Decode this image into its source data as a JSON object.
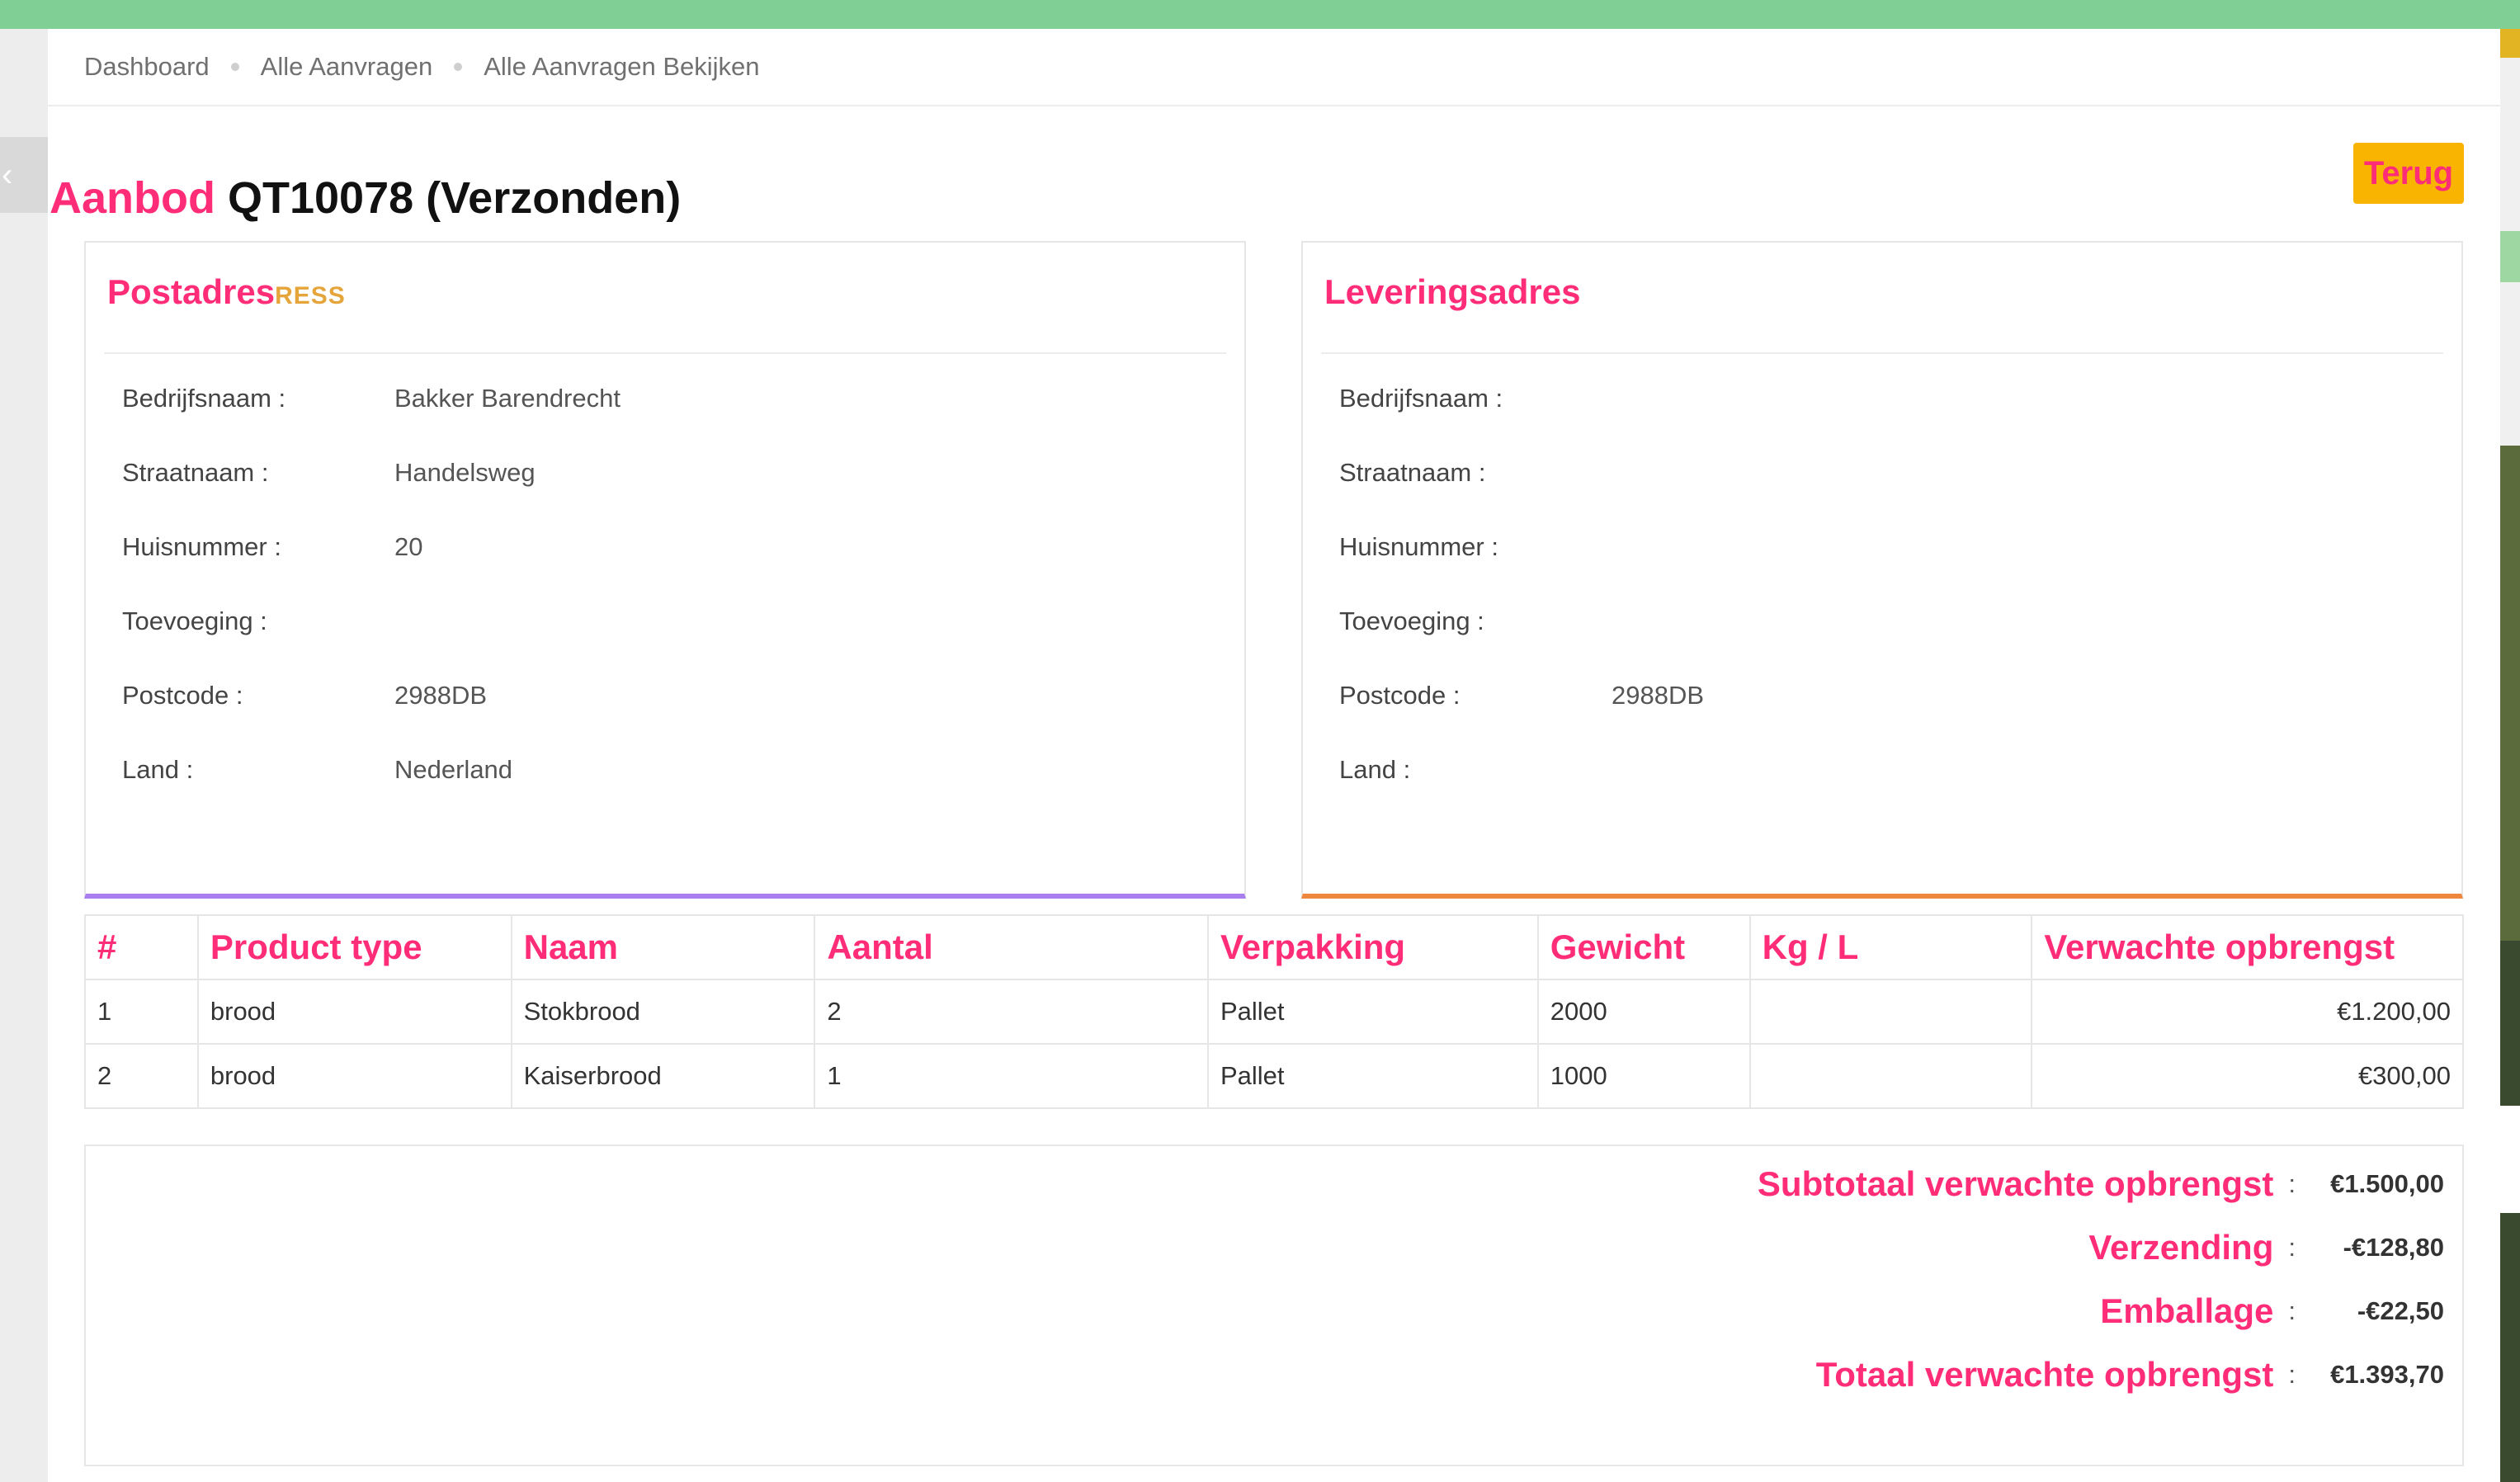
{
  "colors": {
    "topbar": "#80cf95",
    "accent_pink": "#ff2d78",
    "back_button": "#f8b400",
    "postal_border": "#a97ff0",
    "delivery_border": "#f0873e"
  },
  "breadcrumb": [
    "Dashboard",
    "Alle Aanvragen",
    "Alle Aanvragen Bekijken"
  ],
  "page": {
    "title_prefix": "Aanbod",
    "title_rest": "QT10078 (Verzonden)",
    "back_label": "Terug"
  },
  "postal": {
    "title": "Postadres",
    "ghost": "RESS",
    "fields": [
      {
        "label": "Bedrijfsnaam :",
        "value": "Bakker Barendrecht"
      },
      {
        "label": "Straatnaam :",
        "value": "Handelsweg"
      },
      {
        "label": "Huisnummer :",
        "value": "20"
      },
      {
        "label": "Toevoeging :",
        "value": ""
      },
      {
        "label": "Postcode :",
        "value": "2988DB"
      },
      {
        "label": "Land :",
        "value": "Nederland"
      }
    ]
  },
  "delivery": {
    "title": "Leveringsadres",
    "fields": [
      {
        "label": "Bedrijfsnaam :",
        "value": ""
      },
      {
        "label": "Straatnaam :",
        "value": ""
      },
      {
        "label": "Huisnummer :",
        "value": ""
      },
      {
        "label": "Toevoeging :",
        "value": ""
      },
      {
        "label": "Postcode :",
        "value": "2988DB"
      },
      {
        "label": "Land :",
        "value": ""
      }
    ]
  },
  "table": {
    "headers": [
      "#",
      "Product type",
      "Naam",
      "Aantal",
      "Verpakking",
      "Gewicht",
      "Kg / L",
      "Verwachte opbrengst"
    ],
    "rows": [
      [
        "1",
        "brood",
        "Stokbrood",
        "2",
        "Pallet",
        "2000",
        "",
        "€1.200,00"
      ],
      [
        "2",
        "brood",
        "Kaiserbrood",
        "1",
        "Pallet",
        "1000",
        "",
        "€300,00"
      ]
    ]
  },
  "totals": [
    {
      "label": "Subtotaal verwachte opbrengst",
      "colon": ":",
      "value": "€1.500,00"
    },
    {
      "label": "Verzending",
      "colon": ":",
      "value": "-€128,80"
    },
    {
      "label": "Emballage",
      "colon": ":",
      "value": "-€22,50"
    },
    {
      "label": "Totaal verwachte opbrengst",
      "colon": ":",
      "value": "€1.393,70"
    }
  ]
}
